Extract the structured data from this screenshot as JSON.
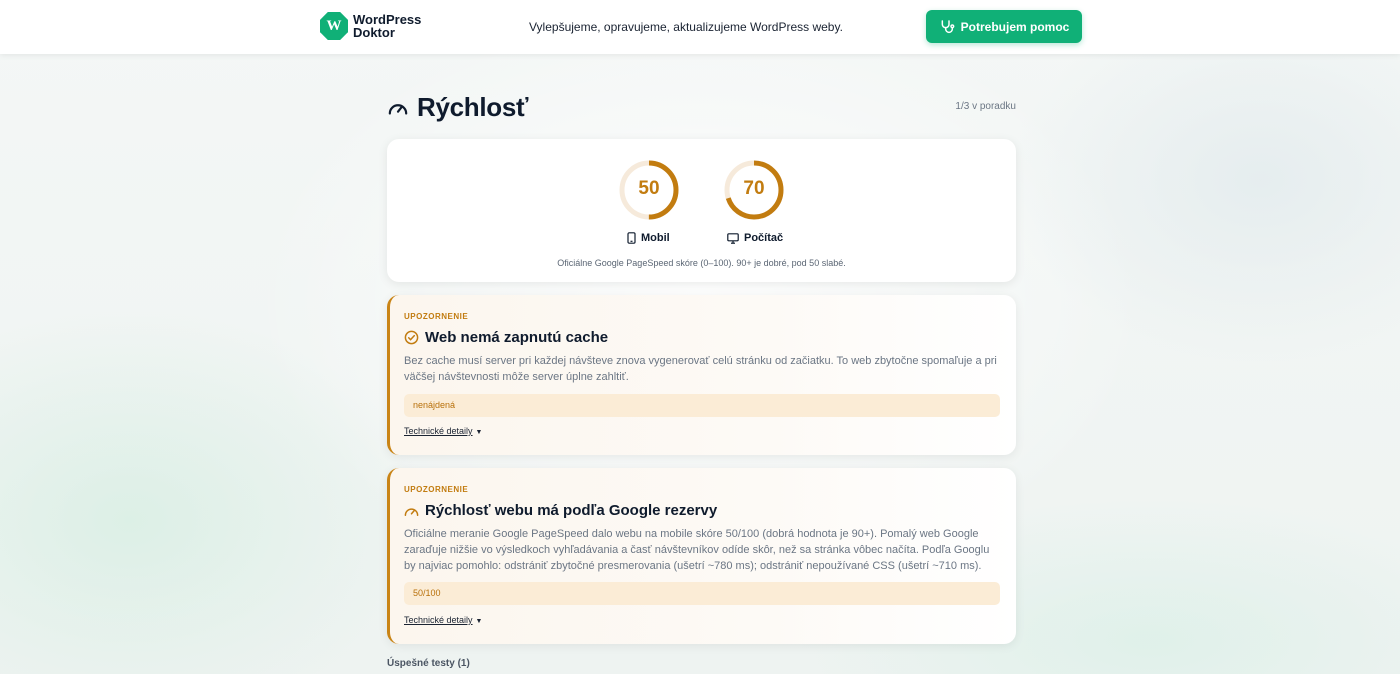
{
  "header": {
    "logo_line1": "WordPress",
    "logo_line2": "Doktor",
    "logo_mark": "W",
    "tagline": "Vylepšujeme, opravujeme, aktualizujeme WordPress weby.",
    "help_button": "Potrebujem pomoc",
    "help_icon": "stethoscope-icon"
  },
  "section": {
    "title": "Rýchlosť",
    "icon": "speedometer-icon",
    "order": "1/3 v poradku"
  },
  "scores": {
    "items": [
      {
        "label": "Mobil",
        "value": 50,
        "max": 100,
        "icon": "smartphone-icon"
      },
      {
        "label": "Počítač",
        "value": 70,
        "max": 100,
        "icon": "monitor-icon"
      }
    ],
    "note": "Oficiálne Google PageSpeed skóre (0–100). 90+ je dobré, pod 50 slabé.",
    "color": "#c27c10",
    "track_color": "#f6eadb"
  },
  "issues": [
    {
      "kicker": "UPOZORNENIE",
      "title": "Web nemá zapnutú cache",
      "icon": "speedometer-check-icon",
      "desc": "Bez cache musí server pri každej návšteve znova vygenerovať celú stránku od začiatku. To web zbytočne spomaľuje a pri väčšej návštevnosti môže server úplne zahltiť.",
      "value": "nenájdená",
      "details": "Technické detaily"
    },
    {
      "kicker": "UPOZORNENIE",
      "title": "Rýchlosť webu má podľa Google rezervy",
      "icon": "speedometer-icon",
      "desc": "Oficiálne meranie Google PageSpeed dalo webu na mobile skóre 50/100 (dobrá hodnota je 90+). Pomalý web Google zaraďuje nižšie vo výsledkoch vyhľadávania a časť návštevníkov odíde skôr, než sa stránka vôbec načíta. Podľa Googlu by najviac pomohlo: odstrániť zbytočné presmerovania (ušetrí ~780 ms); odstrániť nepoužívané CSS (ušetrí ~710 ms).",
      "value": "50/100",
      "details": "Technické detaily"
    }
  ],
  "passed_label": "Úspešné testy (1)",
  "colors": {
    "brand": "#10b077",
    "warning": "#c98416",
    "warning_bg": "#fbecd6"
  }
}
